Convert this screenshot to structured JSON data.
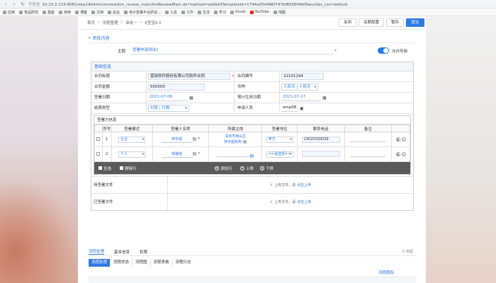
{
  "browser": {
    "insecure": "不安全",
    "url": "10.10.2.119:8081/ekp19b4/km/review/km_review_main/kmReviewMain.do?method=add&fdTemplateId=1794a05d496f747bf8936f4fbf9aca3&s_css=default",
    "bookmarks": [
      "应用",
      "竞品研究",
      "基座",
      "常用",
      "博客",
      "文档",
      "后台",
      "电子签署平台研试...",
      "工具",
      "工作",
      "生活",
      "学习",
      "Gmail",
      "YouTube",
      "地图"
    ]
  },
  "breadcrumb": [
    "首页",
    "流程管理",
    "审批一",
    "E签宝6.0"
  ],
  "top_actions": {
    "close": "关闭",
    "assoc": "关联配置",
    "draft": "暂存",
    "submit": "提交"
  },
  "section_title": "审批内容",
  "subject": {
    "label": "主题",
    "value": "签署申请测试2"
  },
  "toggle_label": "允许传阅",
  "basic": {
    "title": "基础信息",
    "contract_title_label": "合同标题",
    "contract_title": "蓝锐软件股份有限公司软件合同",
    "contract_no_label": "合同编号",
    "contract_no": "22101294",
    "amount_label": "合同金额",
    "amount": "500000",
    "currency_label": "币种",
    "currency": "人民币 | 人民币",
    "sign_date_label": "签署日期",
    "sign_date": "2021-07-08",
    "effective_label": "预计生效日期",
    "effective": "2021-07-17",
    "settle_label": "结算类型",
    "settle": "付款 | 付款",
    "applicant_label": "申请人员",
    "applicant": "amp08"
  },
  "signers": {
    "title": "签署方信息",
    "headers": [
      "序号",
      "签署模式",
      "签署人名称",
      "所属主体",
      "签署地位",
      "联系电话",
      "备注"
    ],
    "rows": [
      {
        "no": "1",
        "mode": "企业",
        "name": "林宇超",
        "entity1": "深圳市南山区",
        "entity2": "林宇超机构",
        "role": "甲方",
        "phone": "13025320039"
      },
      {
        "no": "2",
        "mode": "个人",
        "name": "常雅晏",
        "entity1": "",
        "entity2": "",
        "role": "==请选择==",
        "phone": ""
      }
    ],
    "toolbar": {
      "select_all": "全选",
      "delete": "删除行",
      "add": "添加行",
      "up": "上移",
      "down": "下移"
    }
  },
  "files": [
    {
      "label": "待签署文件",
      "hint": "上传文件，请",
      "link": "点击上传"
    },
    {
      "label": "已签署文件",
      "hint": "上传文件，请",
      "link": "点击上传"
    }
  ],
  "flow_tabs": [
    "流程处理",
    "基本信息",
    "权限"
  ],
  "collapse": "收起",
  "sub_tabs": [
    "流程处理",
    "流程状态",
    "流程图",
    "流程表格",
    "流程日志"
  ],
  "flow_link": "流程跟踪",
  "colors": {
    "accent": "#2d7ae5",
    "toolbar": "#5a5a5a"
  }
}
